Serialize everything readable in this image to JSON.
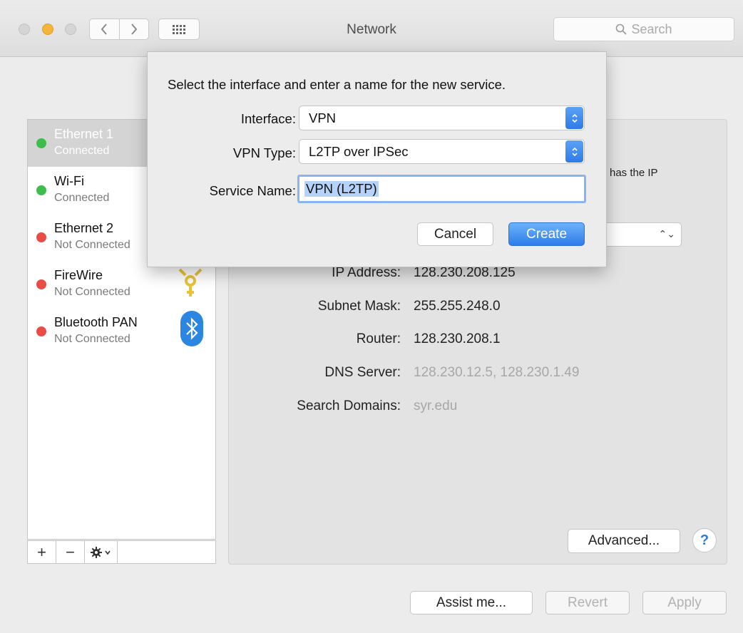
{
  "window": {
    "title": "Network",
    "search_placeholder": "Search"
  },
  "sidebar": {
    "items": [
      {
        "name": "Ethernet 1",
        "status": "Connected",
        "status_color": "#3dbd4a"
      },
      {
        "name": "Wi-Fi",
        "status": "Connected",
        "status_color": "#3dbd4a"
      },
      {
        "name": "Ethernet 2",
        "status": "Not Connected",
        "status_color": "#ea4b44"
      },
      {
        "name": "FireWire",
        "status": "Not Connected",
        "status_color": "#ea4b44"
      },
      {
        "name": "Bluetooth PAN",
        "status": "Not Connected",
        "status_color": "#ea4b44"
      }
    ],
    "toolbar": {
      "add": "+",
      "remove": "−"
    }
  },
  "details": {
    "status_fragment": "has the IP",
    "rows": [
      {
        "label": "IP Address:",
        "value": "128.230.208.125"
      },
      {
        "label": "Subnet Mask:",
        "value": "255.255.248.0"
      },
      {
        "label": "Router:",
        "value": "128.230.208.1"
      },
      {
        "label": "DNS Server:",
        "value": "128.230.12.5, 128.230.1.49"
      },
      {
        "label": "Search Domains:",
        "value": "syr.edu"
      }
    ],
    "advanced_label": "Advanced...",
    "help_label": "?"
  },
  "footer": {
    "assist_label": "Assist me...",
    "revert_label": "Revert",
    "apply_label": "Apply"
  },
  "sheet": {
    "prompt": "Select the interface and enter a name for the new service.",
    "interface_label": "Interface:",
    "interface_value": "VPN",
    "vpn_type_label": "VPN Type:",
    "vpn_type_value": "L2TP over IPSec",
    "service_name_label": "Service Name:",
    "service_name_value": "VPN (L2TP)",
    "cancel_label": "Cancel",
    "create_label": "Create"
  },
  "colors": {
    "accent": "#2e7ce9",
    "connected": "#3dbd4a",
    "not_connected": "#ea4b44"
  }
}
